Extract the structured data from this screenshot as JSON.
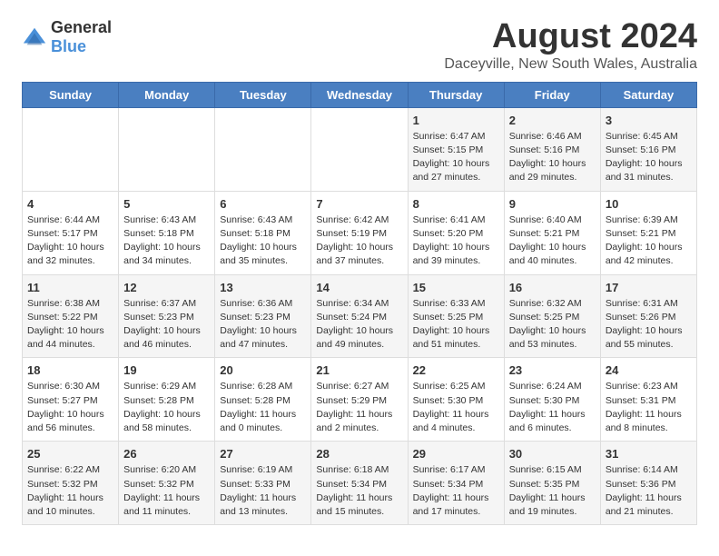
{
  "header": {
    "logo_general": "General",
    "logo_blue": "Blue",
    "title": "August 2024",
    "subtitle": "Daceyville, New South Wales, Australia"
  },
  "weekdays": [
    "Sunday",
    "Monday",
    "Tuesday",
    "Wednesday",
    "Thursday",
    "Friday",
    "Saturday"
  ],
  "weeks": [
    [
      {
        "day": "",
        "info": ""
      },
      {
        "day": "",
        "info": ""
      },
      {
        "day": "",
        "info": ""
      },
      {
        "day": "",
        "info": ""
      },
      {
        "day": "1",
        "info": "Sunrise: 6:47 AM\nSunset: 5:15 PM\nDaylight: 10 hours\nand 27 minutes."
      },
      {
        "day": "2",
        "info": "Sunrise: 6:46 AM\nSunset: 5:16 PM\nDaylight: 10 hours\nand 29 minutes."
      },
      {
        "day": "3",
        "info": "Sunrise: 6:45 AM\nSunset: 5:16 PM\nDaylight: 10 hours\nand 31 minutes."
      }
    ],
    [
      {
        "day": "4",
        "info": "Sunrise: 6:44 AM\nSunset: 5:17 PM\nDaylight: 10 hours\nand 32 minutes."
      },
      {
        "day": "5",
        "info": "Sunrise: 6:43 AM\nSunset: 5:18 PM\nDaylight: 10 hours\nand 34 minutes."
      },
      {
        "day": "6",
        "info": "Sunrise: 6:43 AM\nSunset: 5:18 PM\nDaylight: 10 hours\nand 35 minutes."
      },
      {
        "day": "7",
        "info": "Sunrise: 6:42 AM\nSunset: 5:19 PM\nDaylight: 10 hours\nand 37 minutes."
      },
      {
        "day": "8",
        "info": "Sunrise: 6:41 AM\nSunset: 5:20 PM\nDaylight: 10 hours\nand 39 minutes."
      },
      {
        "day": "9",
        "info": "Sunrise: 6:40 AM\nSunset: 5:21 PM\nDaylight: 10 hours\nand 40 minutes."
      },
      {
        "day": "10",
        "info": "Sunrise: 6:39 AM\nSunset: 5:21 PM\nDaylight: 10 hours\nand 42 minutes."
      }
    ],
    [
      {
        "day": "11",
        "info": "Sunrise: 6:38 AM\nSunset: 5:22 PM\nDaylight: 10 hours\nand 44 minutes."
      },
      {
        "day": "12",
        "info": "Sunrise: 6:37 AM\nSunset: 5:23 PM\nDaylight: 10 hours\nand 46 minutes."
      },
      {
        "day": "13",
        "info": "Sunrise: 6:36 AM\nSunset: 5:23 PM\nDaylight: 10 hours\nand 47 minutes."
      },
      {
        "day": "14",
        "info": "Sunrise: 6:34 AM\nSunset: 5:24 PM\nDaylight: 10 hours\nand 49 minutes."
      },
      {
        "day": "15",
        "info": "Sunrise: 6:33 AM\nSunset: 5:25 PM\nDaylight: 10 hours\nand 51 minutes."
      },
      {
        "day": "16",
        "info": "Sunrise: 6:32 AM\nSunset: 5:25 PM\nDaylight: 10 hours\nand 53 minutes."
      },
      {
        "day": "17",
        "info": "Sunrise: 6:31 AM\nSunset: 5:26 PM\nDaylight: 10 hours\nand 55 minutes."
      }
    ],
    [
      {
        "day": "18",
        "info": "Sunrise: 6:30 AM\nSunset: 5:27 PM\nDaylight: 10 hours\nand 56 minutes."
      },
      {
        "day": "19",
        "info": "Sunrise: 6:29 AM\nSunset: 5:28 PM\nDaylight: 10 hours\nand 58 minutes."
      },
      {
        "day": "20",
        "info": "Sunrise: 6:28 AM\nSunset: 5:28 PM\nDaylight: 11 hours\nand 0 minutes."
      },
      {
        "day": "21",
        "info": "Sunrise: 6:27 AM\nSunset: 5:29 PM\nDaylight: 11 hours\nand 2 minutes."
      },
      {
        "day": "22",
        "info": "Sunrise: 6:25 AM\nSunset: 5:30 PM\nDaylight: 11 hours\nand 4 minutes."
      },
      {
        "day": "23",
        "info": "Sunrise: 6:24 AM\nSunset: 5:30 PM\nDaylight: 11 hours\nand 6 minutes."
      },
      {
        "day": "24",
        "info": "Sunrise: 6:23 AM\nSunset: 5:31 PM\nDaylight: 11 hours\nand 8 minutes."
      }
    ],
    [
      {
        "day": "25",
        "info": "Sunrise: 6:22 AM\nSunset: 5:32 PM\nDaylight: 11 hours\nand 10 minutes."
      },
      {
        "day": "26",
        "info": "Sunrise: 6:20 AM\nSunset: 5:32 PM\nDaylight: 11 hours\nand 11 minutes."
      },
      {
        "day": "27",
        "info": "Sunrise: 6:19 AM\nSunset: 5:33 PM\nDaylight: 11 hours\nand 13 minutes."
      },
      {
        "day": "28",
        "info": "Sunrise: 6:18 AM\nSunset: 5:34 PM\nDaylight: 11 hours\nand 15 minutes."
      },
      {
        "day": "29",
        "info": "Sunrise: 6:17 AM\nSunset: 5:34 PM\nDaylight: 11 hours\nand 17 minutes."
      },
      {
        "day": "30",
        "info": "Sunrise: 6:15 AM\nSunset: 5:35 PM\nDaylight: 11 hours\nand 19 minutes."
      },
      {
        "day": "31",
        "info": "Sunrise: 6:14 AM\nSunset: 5:36 PM\nDaylight: 11 hours\nand 21 minutes."
      }
    ]
  ]
}
